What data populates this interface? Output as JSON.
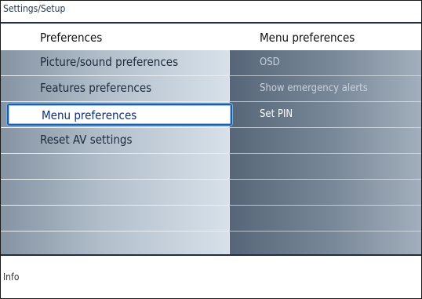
{
  "breadcrumb": "Settings/Setup",
  "left_column": {
    "title": "Preferences",
    "items": [
      {
        "label": "Picture/sound preferences"
      },
      {
        "label": "Features preferences"
      },
      {
        "label": "Menu preferences",
        "selected": true
      },
      {
        "label": "Reset AV settings"
      },
      {
        "label": ""
      },
      {
        "label": ""
      },
      {
        "label": ""
      },
      {
        "label": ""
      }
    ]
  },
  "right_column": {
    "title": "Menu preferences",
    "items": [
      {
        "label": "OSD",
        "enabled": false
      },
      {
        "label": "Show emergency alerts",
        "enabled": false
      },
      {
        "label": "Set PIN",
        "enabled": true
      },
      {
        "label": ""
      },
      {
        "label": ""
      },
      {
        "label": ""
      },
      {
        "label": ""
      },
      {
        "label": ""
      }
    ]
  },
  "footer": {
    "info_label": "Info"
  },
  "colors": {
    "selection_border": "#1d5ea8",
    "selected_text": "#0d2f76",
    "header_rule": "#1c2f47"
  }
}
